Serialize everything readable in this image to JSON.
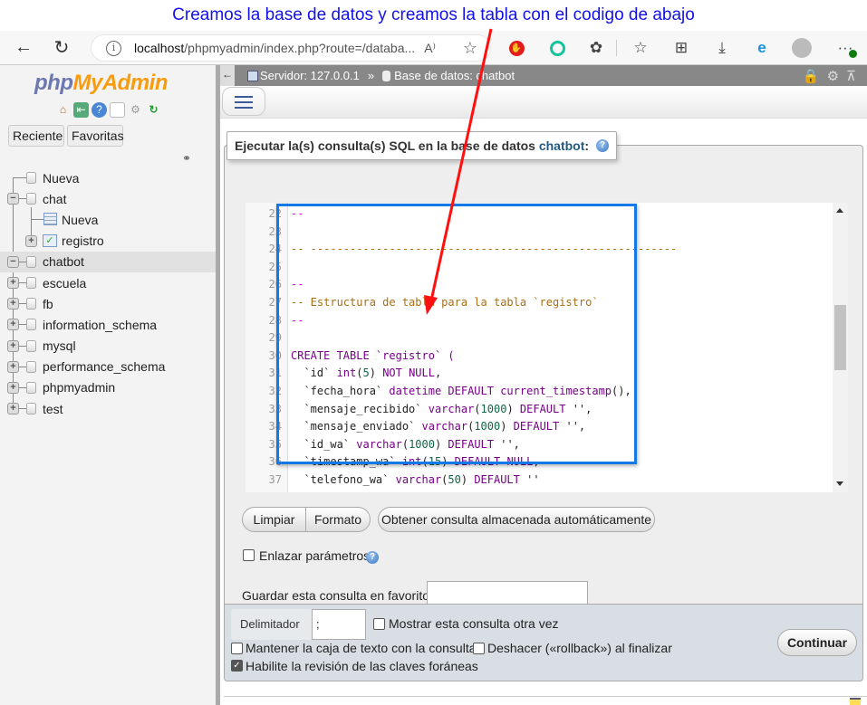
{
  "annotation": {
    "caption": "Creamos la base de datos y creamos la tabla con el codigo de abajo",
    "caption_color": "#1212e8",
    "arrow_color": "#ff0000",
    "highlight_color": "#1478e6"
  },
  "browser": {
    "back_icon": "arrow-left-icon",
    "reload_icon": "reload-icon",
    "url_host": "localhost",
    "url_path": "/phpmyadmin/index.php?route=/databa...",
    "read_aloud_label": "A⁾",
    "extensions": [
      "adblock-icon",
      "grammarly-icon",
      "extensions-icon",
      "favorites-icon",
      "collections-icon",
      "downloads-icon",
      "ie-mode-icon",
      "profile-icon",
      "more-icon"
    ]
  },
  "sidebar": {
    "logo_php": "php",
    "logo_myadmin": "MyAdmin",
    "quick_icons": [
      "home-icon",
      "logout-icon",
      "help-icon",
      "docs-icon",
      "settings-icon",
      "reload-icon"
    ],
    "tabs": [
      {
        "label": "Reciente"
      },
      {
        "label": "Favoritas"
      }
    ],
    "tree": [
      {
        "label": "Nueva",
        "level": 0,
        "expander": "",
        "icon": "new-db"
      },
      {
        "label": "chat",
        "level": 0,
        "expander": "−",
        "icon": "db"
      },
      {
        "label": "Nueva",
        "level": 1,
        "expander": "",
        "icon": "new-table"
      },
      {
        "label": "registro",
        "level": 1,
        "expander": "+",
        "icon": "table"
      },
      {
        "label": "chatbot",
        "level": 0,
        "expander": "−",
        "icon": "db",
        "selected": true
      },
      {
        "label": "escuela",
        "level": 0,
        "expander": "+",
        "icon": "db"
      },
      {
        "label": "fb",
        "level": 0,
        "expander": "+",
        "icon": "db"
      },
      {
        "label": "information_schema",
        "level": 0,
        "expander": "+",
        "icon": "db"
      },
      {
        "label": "mysql",
        "level": 0,
        "expander": "+",
        "icon": "db"
      },
      {
        "label": "performance_schema",
        "level": 0,
        "expander": "+",
        "icon": "db"
      },
      {
        "label": "phpmyadmin",
        "level": 0,
        "expander": "+",
        "icon": "db"
      },
      {
        "label": "test",
        "level": 0,
        "expander": "+",
        "icon": "db"
      }
    ]
  },
  "topbar": {
    "server_label": "Servidor: 127.0.0.1",
    "separator": "»",
    "db_label": "Base de datos: chatbot"
  },
  "sql": {
    "legend_text": "Ejecutar la(s) consulta(s) SQL en la base de datos",
    "legend_db": "chatbot",
    "legend_suffix": ":",
    "lines": [
      {
        "n": "22",
        "parts": [
          {
            "t": "--",
            "c": "c-dash"
          }
        ]
      },
      {
        "n": "23",
        "parts": []
      },
      {
        "n": "24",
        "parts": [
          {
            "t": "-- --------------------------------------------------------",
            "c": "c-comment"
          }
        ]
      },
      {
        "n": "25",
        "parts": []
      },
      {
        "n": "26",
        "parts": [
          {
            "t": "--",
            "c": "c-dash"
          }
        ]
      },
      {
        "n": "27",
        "parts": [
          {
            "t": "-- Estructura de tabla para la tabla `registro`",
            "c": "c-comment"
          }
        ]
      },
      {
        "n": "28",
        "parts": [
          {
            "t": "--",
            "c": "c-dash"
          }
        ]
      },
      {
        "n": "29",
        "parts": []
      },
      {
        "n": "30",
        "parts": [
          {
            "t": "CREATE TABLE ",
            "c": "c-kw"
          },
          {
            "t": "`registro`",
            "c": "c-kw"
          },
          {
            "t": " (",
            "c": "c-kw"
          }
        ]
      },
      {
        "n": "31",
        "parts": [
          {
            "t": "  `id` ",
            "c": "c-bt"
          },
          {
            "t": "int",
            "c": "c-kw"
          },
          {
            "t": "(",
            "c": "c-bt"
          },
          {
            "t": "5",
            "c": "c-num"
          },
          {
            "t": ") ",
            "c": "c-bt"
          },
          {
            "t": "NOT NULL",
            "c": "c-kw"
          },
          {
            "t": ",",
            "c": "c-bt"
          }
        ]
      },
      {
        "n": "32",
        "parts": [
          {
            "t": "  `fecha_hora` ",
            "c": "c-bt"
          },
          {
            "t": "datetime DEFAULT current_timestamp",
            "c": "c-kw"
          },
          {
            "t": "(),",
            "c": "c-bt"
          }
        ]
      },
      {
        "n": "33",
        "parts": [
          {
            "t": "  `mensaje_recibido` ",
            "c": "c-bt"
          },
          {
            "t": "varchar",
            "c": "c-kw"
          },
          {
            "t": "(",
            "c": "c-bt"
          },
          {
            "t": "1000",
            "c": "c-num"
          },
          {
            "t": ") ",
            "c": "c-bt"
          },
          {
            "t": "DEFAULT",
            "c": "c-kw"
          },
          {
            "t": " '',",
            "c": "c-bt"
          }
        ]
      },
      {
        "n": "34",
        "parts": [
          {
            "t": "  `mensaje_enviado` ",
            "c": "c-bt"
          },
          {
            "t": "varchar",
            "c": "c-kw"
          },
          {
            "t": "(",
            "c": "c-bt"
          },
          {
            "t": "1000",
            "c": "c-num"
          },
          {
            "t": ") ",
            "c": "c-bt"
          },
          {
            "t": "DEFAULT",
            "c": "c-kw"
          },
          {
            "t": " '',",
            "c": "c-bt"
          }
        ]
      },
      {
        "n": "35",
        "parts": [
          {
            "t": "  `id_wa` ",
            "c": "c-bt"
          },
          {
            "t": "varchar",
            "c": "c-kw"
          },
          {
            "t": "(",
            "c": "c-bt"
          },
          {
            "t": "1000",
            "c": "c-num"
          },
          {
            "t": ") ",
            "c": "c-bt"
          },
          {
            "t": "DEFAULT",
            "c": "c-kw"
          },
          {
            "t": " '',",
            "c": "c-bt"
          }
        ]
      },
      {
        "n": "36",
        "parts": [
          {
            "t": "  `timestamp_wa` ",
            "c": "c-bt"
          },
          {
            "t": "int",
            "c": "c-kw"
          },
          {
            "t": "(",
            "c": "c-bt"
          },
          {
            "t": "15",
            "c": "c-num"
          },
          {
            "t": ") ",
            "c": "c-bt"
          },
          {
            "t": "DEFAULT NULL",
            "c": "c-kw"
          },
          {
            "t": ",",
            "c": "c-bt"
          }
        ]
      },
      {
        "n": "37",
        "parts": [
          {
            "t": "  `telefono_wa` ",
            "c": "c-bt"
          },
          {
            "t": "varchar",
            "c": "c-kw"
          },
          {
            "t": "(",
            "c": "c-bt"
          },
          {
            "t": "50",
            "c": "c-num"
          },
          {
            "t": ") ",
            "c": "c-bt"
          },
          {
            "t": "DEFAULT",
            "c": "c-kw"
          },
          {
            "t": " ''",
            "c": "c-bt"
          }
        ]
      }
    ],
    "buttons": {
      "clear": "Limpiar",
      "format": "Formato",
      "get_autosaved": "Obtener consulta almacenada automáticamente"
    },
    "bind_params_label": "Enlazar parámetros",
    "bind_params_checked": false,
    "bookmark_label": "Guardar esta consulta en favoritos:",
    "bookmark_value": ""
  },
  "footer": {
    "delimiter_label": "Delimitador",
    "delimiter_value": ";",
    "show_query_label": "Mostrar esta consulta otra vez",
    "show_query_checked": false,
    "retain_box_label": "Mantener la caja de texto con la consulta",
    "retain_box_checked": false,
    "rollback_label": "Deshacer («rollback») al finalizar",
    "rollback_checked": false,
    "fk_checks_label": "Habilite la revisión de las claves foráneas",
    "fk_checks_checked": true,
    "submit_label": "Continuar"
  }
}
